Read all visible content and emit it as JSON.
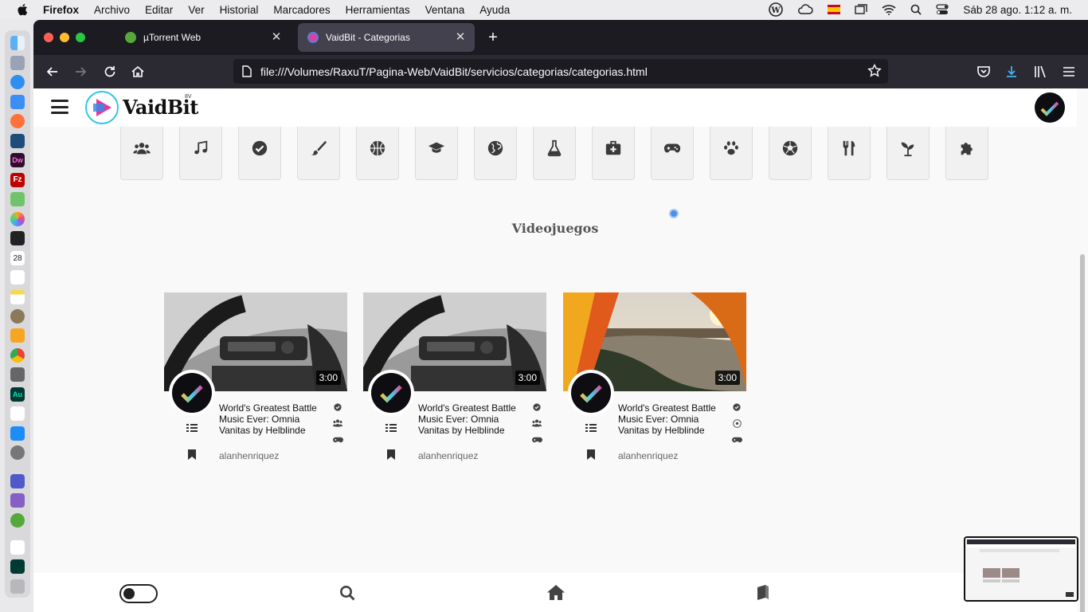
{
  "menubar": {
    "app": "Firefox",
    "items": [
      "Archivo",
      "Editar",
      "Ver",
      "Historial",
      "Marcadores",
      "Herramientas",
      "Ventana",
      "Ayuda"
    ],
    "clock": "Sáb 28 ago.  1:12 a. m."
  },
  "browser": {
    "tabs": [
      {
        "title": "µTorrent Web",
        "icon": "utorrent-icon",
        "active": false
      },
      {
        "title": "VaidBit - Categorias",
        "icon": "vaidbit-icon",
        "active": true
      }
    ],
    "url": "file:///Volumes/RaxuT/Pagina-Web/VaidBit/servicios/categorias/categorias.html"
  },
  "site": {
    "logo_text": "VaidBit",
    "logo_superscript": "8V",
    "section_title": "Videojuegos",
    "categories": [
      {
        "icon": "users-icon"
      },
      {
        "icon": "music-icon"
      },
      {
        "icon": "check-circle-icon"
      },
      {
        "icon": "paintbrush-icon"
      },
      {
        "icon": "basketball-icon"
      },
      {
        "icon": "graduation-cap-icon"
      },
      {
        "icon": "globe-icon"
      },
      {
        "icon": "flask-icon"
      },
      {
        "icon": "medical-kit-icon"
      },
      {
        "icon": "gamepad-icon"
      },
      {
        "icon": "paw-icon"
      },
      {
        "icon": "soccer-ball-icon"
      },
      {
        "icon": "utensils-icon"
      },
      {
        "icon": "seedling-icon"
      },
      {
        "icon": "puzzle-icon"
      }
    ],
    "videos": [
      {
        "duration": "3:00",
        "title": "World's Greatest Battle Music Ever: Omnia Vanitas by Helblinde",
        "author": "alanhenriquez",
        "thumbnail": "car-dashboard",
        "category_icons": [
          "check-circle-icon",
          "users-icon",
          "gamepad-icon"
        ]
      },
      {
        "duration": "3:00",
        "title": "World's Greatest Battle Music Ever: Omnia Vanitas by Helblinde",
        "author": "alanhenriquez",
        "thumbnail": "car-dashboard",
        "category_icons": [
          "check-circle-icon",
          "users-icon",
          "gamepad-icon"
        ]
      },
      {
        "duration": "3:00",
        "title": "World's Greatest Battle Music Ever: Omnia Vanitas by Helblinde",
        "author": "alanhenriquez",
        "thumbnail": "sunset-coast",
        "category_icons": [
          "check-circle-icon",
          "soccer-ball-icon",
          "gamepad-icon"
        ]
      }
    ],
    "bottom_nav": [
      "theme-toggle",
      "search-icon",
      "home-icon",
      "book-icon"
    ]
  }
}
